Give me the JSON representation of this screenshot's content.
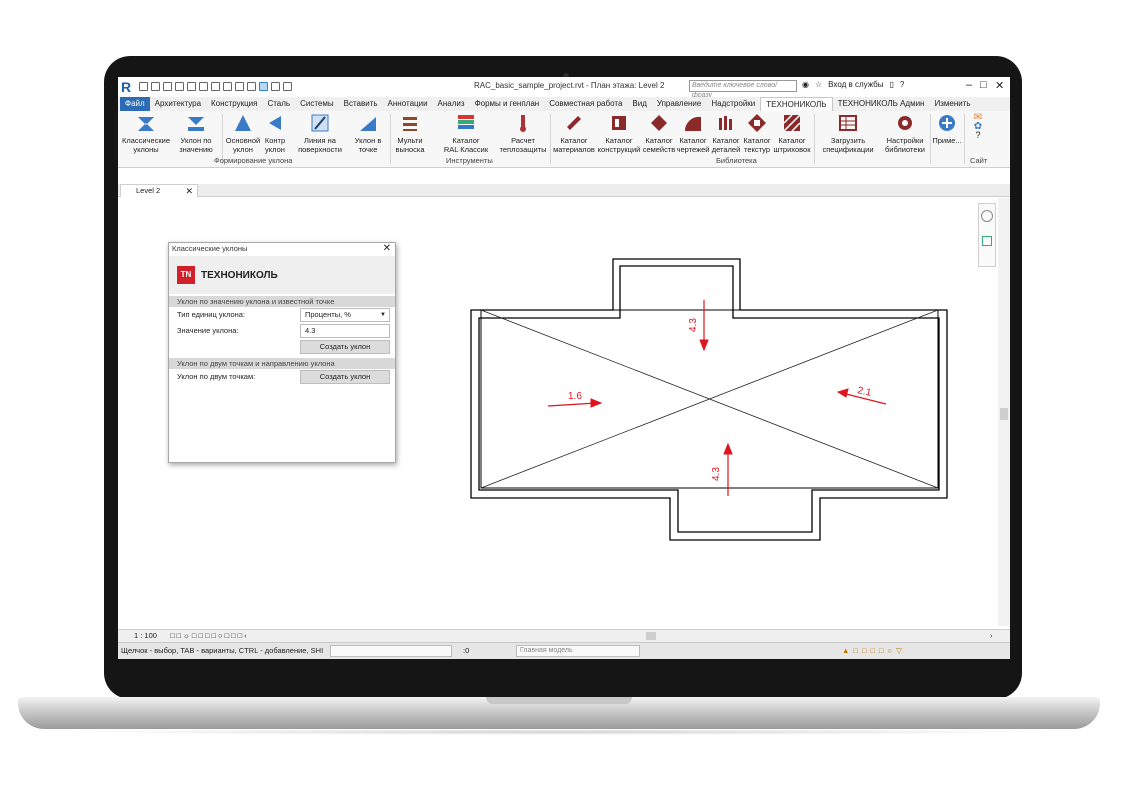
{
  "window": {
    "title": "RAC_basic_sample_project.rvt - План этажа: Level 2",
    "search_placeholder": "Введите ключевое слово/фразу",
    "signin": "Вход в службы",
    "help": "?"
  },
  "menu_tabs": [
    "Файл",
    "Архитектура",
    "Конструкция",
    "Сталь",
    "Системы",
    "Вставить",
    "Аннотации",
    "Анализ",
    "Формы и генплан",
    "Совместная работа",
    "Вид",
    "Управление",
    "Надстройки",
    "ТЕХНОНИКОЛЬ",
    "ТЕХНОНИКОЛЬ Админ",
    "Изменить"
  ],
  "ribbon": {
    "buttons": [
      {
        "line1": "Классические",
        "line2": "уклоны"
      },
      {
        "line1": "Уклон по",
        "line2": "значению"
      },
      {
        "line1": "Основной",
        "line2": "уклон"
      },
      {
        "line1": "Контр",
        "line2": "уклон"
      },
      {
        "line1": "Линия на",
        "line2": "поверхности"
      },
      {
        "line1": "Уклон в",
        "line2": "точке"
      },
      {
        "line1": "Мульти",
        "line2": "выноска"
      },
      {
        "line1": "Каталог",
        "line2": "RAL Классик"
      },
      {
        "line1": "Расчет",
        "line2": "теплозащиты"
      },
      {
        "line1": "Каталог",
        "line2": "материалов"
      },
      {
        "line1": "Каталог",
        "line2": "конструкций"
      },
      {
        "line1": "Каталог",
        "line2": "семейств"
      },
      {
        "line1": "Каталог",
        "line2": "чертежей"
      },
      {
        "line1": "Каталог",
        "line2": "деталей"
      },
      {
        "line1": "Каталог",
        "line2": "текстур"
      },
      {
        "line1": "Каталог",
        "line2": "штриховок"
      },
      {
        "line1": "Загрузить",
        "line2": "спецификации"
      },
      {
        "line1": "Настройки",
        "line2": "библиотеки"
      },
      {
        "line1": "Приме...",
        "line2": ""
      }
    ],
    "groups": [
      "Формирование уклона",
      "Инструменты",
      "Библиотека",
      "Сайт"
    ]
  },
  "view_tab": {
    "label": "Level 2"
  },
  "dialog": {
    "title": "Классические уклоны",
    "brand_logo": "TN",
    "brand": "ТЕХНОНИКОЛЬ",
    "section1": "Уклон по значению уклона и известной точке",
    "unit_type_label": "Тип единиц уклона:",
    "unit_type_value": "Проценты, %",
    "slope_value_label": "Значение уклона:",
    "slope_value": "4.3",
    "create_button": "Создать уклон",
    "section2": "Уклон по двум точкам и направлению уклона",
    "two_points_label": "Уклон по двум точкам:",
    "create_button2": "Создать уклон"
  },
  "drawing": {
    "slope_labels": [
      "4.3",
      "2.1",
      "1.6",
      "4.3"
    ],
    "arrow_color": "#e0141e"
  },
  "bottom_bar": {
    "scale": "1 : 100"
  },
  "status": {
    "hint": "Щелчок - выбор, TAB - варианты, CTRL - добавление, SHI",
    "count": ":0",
    "model": "Главная модель"
  }
}
